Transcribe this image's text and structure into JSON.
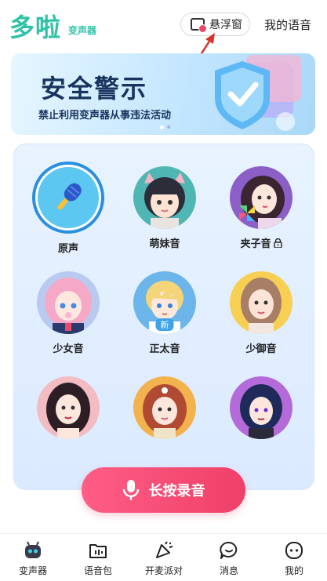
{
  "header": {
    "logo": "多啦",
    "logo_sub": "变声器",
    "float_window": "悬浮窗",
    "my_voice": "我的语音"
  },
  "banner": {
    "title": "安全警示",
    "subtitle": "禁止利用变声器从事违法活动",
    "page_dots": 2,
    "active_dot": 0
  },
  "voices": [
    {
      "label": "原声",
      "icon": "microphone-icon",
      "locked": false,
      "selected": true
    },
    {
      "label": "萌妹音",
      "icon": "cat-ear-girl-avatar",
      "locked": false,
      "selected": false
    },
    {
      "label": "夹子音",
      "icon": "pinwheel-girl-avatar",
      "locked": true,
      "selected": false
    },
    {
      "label": "少女音",
      "icon": "pink-hair-girl-avatar",
      "locked": false,
      "selected": false
    },
    {
      "label": "正太音",
      "icon": "blond-boy-avatar",
      "locked": false,
      "selected": false,
      "badge": "新"
    },
    {
      "label": "少御音",
      "icon": "mature-woman-avatar",
      "locked": false,
      "selected": false
    },
    {
      "label": "",
      "icon": "dark-hair-woman-avatar"
    },
    {
      "label": "",
      "icon": "red-hair-girl-avatar"
    },
    {
      "label": "",
      "icon": "navy-hair-woman-avatar"
    }
  ],
  "record_button": {
    "label": "长按录音",
    "icon": "microphone-icon"
  },
  "nav": {
    "items": [
      {
        "label": "变声器",
        "icon": "robot-icon",
        "active": true
      },
      {
        "label": "语音包",
        "icon": "folder-audio-icon",
        "active": false
      },
      {
        "label": "开麦派对",
        "icon": "party-horn-icon",
        "active": false
      },
      {
        "label": "消息",
        "icon": "chat-bubble-icon",
        "active": false
      },
      {
        "label": "我的",
        "icon": "profile-face-icon",
        "active": false
      }
    ]
  },
  "colors": {
    "brand": "#2fc2a8",
    "accent_pink": "#ef4068",
    "selected_ring": "#2b8fe0",
    "banner_text": "#17335e"
  }
}
